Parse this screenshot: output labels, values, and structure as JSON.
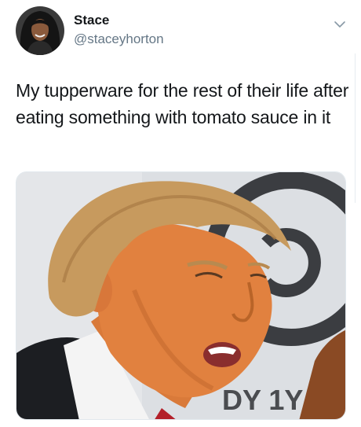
{
  "tweet": {
    "display_name": "Stace",
    "handle": "@staceyhorton",
    "text": "My tupperware for the rest of their life after eating something with tomato sauce in it",
    "media": {
      "background_logo_text": "DY 1Y"
    }
  },
  "icons": {
    "menu": "chevron-down-icon"
  },
  "colors": {
    "name": "#14171a",
    "handle": "#657786",
    "chevron": "#8899a6",
    "border": "#e1e8ed"
  }
}
